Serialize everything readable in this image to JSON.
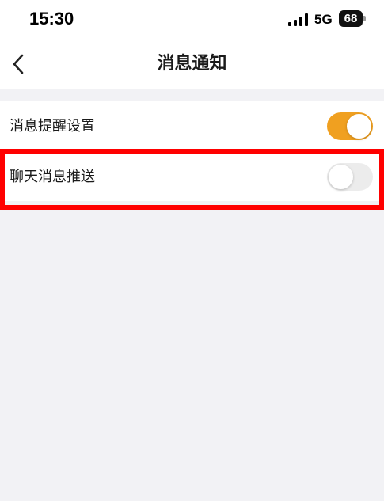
{
  "status_bar": {
    "time": "15:30",
    "network": "5G",
    "battery_level": "68",
    "signal_icon": "cellular-signal-icon",
    "battery_icon": "battery-icon"
  },
  "nav": {
    "title": "消息通知",
    "back_icon": "chevron-left-icon"
  },
  "settings": [
    {
      "label": "消息提醒设置",
      "enabled": true
    },
    {
      "label": "聊天消息推送",
      "enabled": false
    }
  ],
  "colors": {
    "accent": "#f0a020",
    "highlight": "#ff0000",
    "background": "#f2f2f5"
  }
}
